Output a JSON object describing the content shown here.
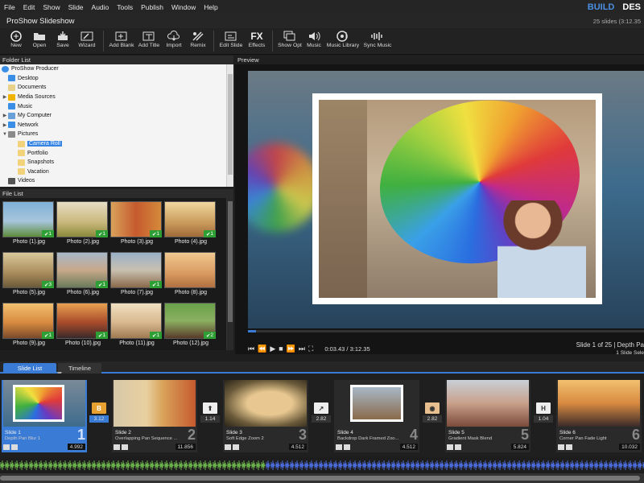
{
  "menu": [
    "File",
    "Edit",
    "Show",
    "Slide",
    "Audio",
    "Tools",
    "Publish",
    "Window",
    "Help"
  ],
  "modes": {
    "build": "BUILD",
    "design": "DES"
  },
  "window": {
    "title": "ProShow Slideshow",
    "slide_count": "25 slides (3:12.35"
  },
  "toolbar": [
    "New",
    "Open",
    "Save",
    "Wizard",
    "Add Blank",
    "Add Title",
    "Import",
    "Remix",
    "Edit Slide",
    "Effects",
    "Show Opt",
    "Music",
    "Music Library",
    "Sync Music"
  ],
  "folder_list": {
    "header": "Folder List",
    "items": [
      "ProShow Producer",
      "Desktop",
      "Documents",
      "Media Sources",
      "Music",
      "My Computer",
      "Network",
      "Pictures",
      "Camera Roll",
      "Portfolio",
      "Snapshots",
      "Vacation",
      "Videos"
    ]
  },
  "file_list": {
    "header": "File List",
    "files": [
      {
        "name": "Photo (1).jpg",
        "count": "1"
      },
      {
        "name": "Photo (2).jpg",
        "count": "1"
      },
      {
        "name": "Photo (3).jpg",
        "count": "1"
      },
      {
        "name": "Photo (4).jpg",
        "count": "1"
      },
      {
        "name": "Photo (5).jpg",
        "count": "3"
      },
      {
        "name": "Photo (6).jpg",
        "count": "1"
      },
      {
        "name": "Photo (7).jpg",
        "count": "1"
      },
      {
        "name": "Photo (8).jpg",
        "count": ""
      },
      {
        "name": "Photo (9).jpg",
        "count": "1"
      },
      {
        "name": "Photo (10).jpg",
        "count": "1"
      },
      {
        "name": "Photo (11).jpg",
        "count": "1"
      },
      {
        "name": "Photo (12).jpg",
        "count": "2"
      }
    ]
  },
  "preview": {
    "header": "Preview",
    "time": "0:03.43 / 3:12.35",
    "slide_info": "Slide 1 of 25  |  Depth Pa",
    "slide_sel": "1 Slide Sele"
  },
  "tabs": {
    "slide_list": "Slide List",
    "timeline": "Timeline"
  },
  "slides": [
    {
      "title": "Slide 1",
      "sub": "Depth Pan Blur 1",
      "num": "1",
      "dur": "4.992"
    },
    {
      "title": "Slide 2",
      "sub": "Overlapping Pan Sequence ...",
      "num": "2",
      "dur": "11.856"
    },
    {
      "title": "Slide 3",
      "sub": "Soft Edge Zoom 2",
      "num": "3",
      "dur": "4.512"
    },
    {
      "title": "Slide 4",
      "sub": "Backdrop Dark Framed Zoo...",
      "num": "4",
      "dur": "4.512"
    },
    {
      "title": "Slide 5",
      "sub": "Gradient Mask Blend",
      "num": "5",
      "dur": "5.824"
    },
    {
      "title": "Slide 6",
      "sub": "Corner Pan Fade Light",
      "num": "6",
      "dur": "10.032"
    }
  ],
  "transitions": [
    "3.12",
    "1.14",
    "2.82",
    "2.82",
    "1.04"
  ],
  "colors": {
    "accent": "#3a7bd5",
    "check": "#2e9f35",
    "build": "#4a90e2"
  }
}
